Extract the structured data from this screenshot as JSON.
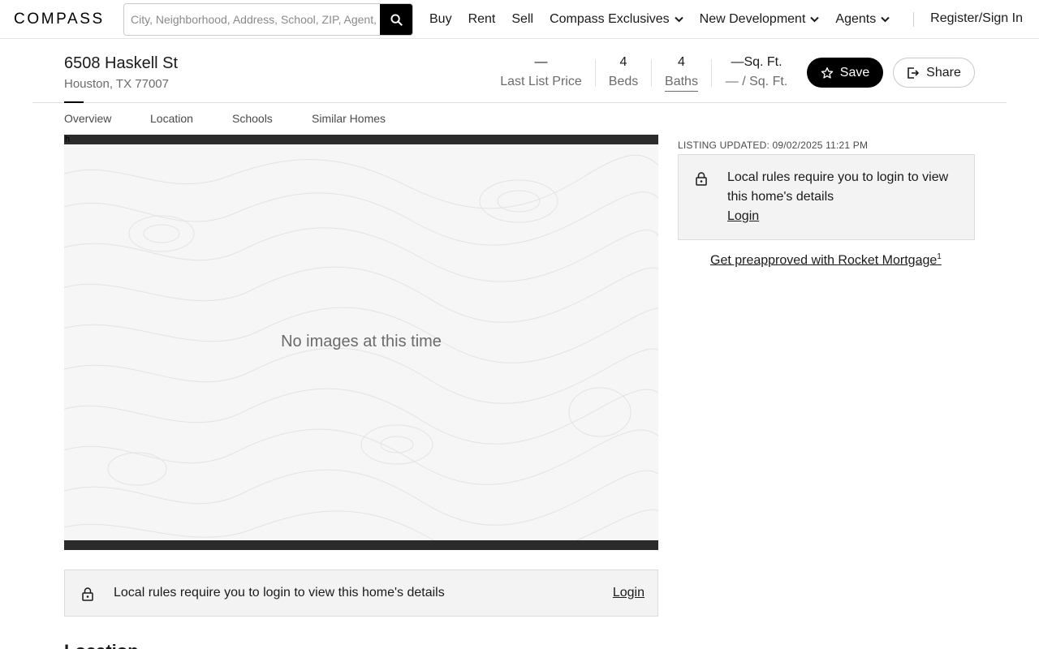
{
  "nav": {
    "logo": "COMPASS",
    "search_placeholder": "City, Neighborhood, Address, School, ZIP, Agent, ID",
    "links": [
      "Buy",
      "Rent",
      "Sell",
      "Compass Exclusives",
      "New Development",
      "Agents"
    ],
    "signin": "Register/Sign In"
  },
  "listing": {
    "address": "6508 Haskell St",
    "city": "Houston, TX 77007",
    "price_value": "—",
    "price_label": "Last List Price",
    "beds_value": "4",
    "beds_label": "Beds",
    "baths_value": "4",
    "baths_label": "Baths",
    "sqft_value": "—Sq. Ft.",
    "sqft_label": "— / Sq. Ft.",
    "save_label": "Save",
    "share_label": "Share"
  },
  "tabs": [
    "Overview",
    "Location",
    "Schools",
    "Similar Homes"
  ],
  "photo": {
    "tag": "h",
    "no_images": "No images at this time"
  },
  "login_bar": {
    "message": "Local rules require you to login to view this home's details",
    "link": "Login"
  },
  "sidebar": {
    "updated": "LISTING UPDATED: 09/02/2025 11:21 PM",
    "card_message": "Local rules require you to login to view this home's details",
    "card_link": "Login",
    "preapproved": "Get preapproved with Rocket Mortgage",
    "preapproved_sup": "1"
  },
  "next_section": "Location",
  "icons": {
    "search": "search-icon",
    "chevron": "chevron-down-icon",
    "star": "star-icon",
    "share": "share-icon",
    "lock": "lock-icon"
  }
}
